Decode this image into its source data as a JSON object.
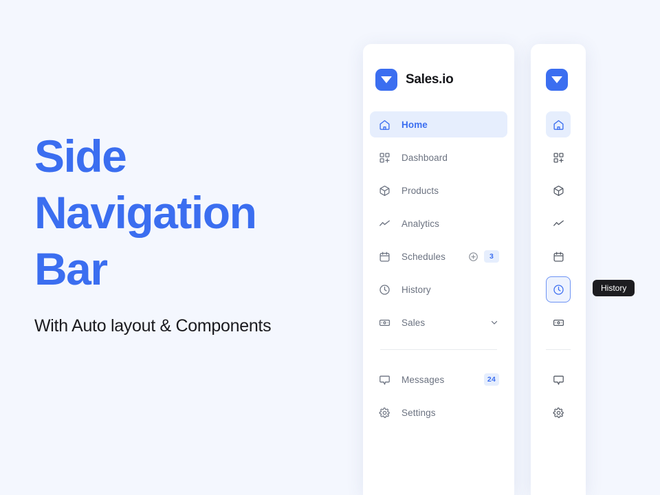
{
  "page": {
    "background_color": "#f4f7fe",
    "accent_color": "#3b6ef0",
    "muted_text_color": "#6b7280"
  },
  "hero": {
    "title": "Side\nNavigation\nBar",
    "subtitle": "With Auto layout & Components"
  },
  "sidebar": {
    "brand": {
      "name": "Sales.io",
      "logo_icon": "triangle-down-icon",
      "logo_color": "#3b6ef0"
    },
    "items": [
      {
        "label": "Home",
        "icon": "home-icon",
        "active": true,
        "badge": null,
        "action_icon": null,
        "chevron": false
      },
      {
        "label": "Dashboard",
        "icon": "dashboard-icon",
        "active": false,
        "badge": null,
        "action_icon": null,
        "chevron": false
      },
      {
        "label": "Products",
        "icon": "box-icon",
        "active": false,
        "badge": null,
        "action_icon": null,
        "chevron": false
      },
      {
        "label": "Analytics",
        "icon": "chart-line-icon",
        "active": false,
        "badge": null,
        "action_icon": null,
        "chevron": false
      },
      {
        "label": "Schedules",
        "icon": "calendar-icon",
        "active": false,
        "badge": "3",
        "action_icon": "plus-circle-icon",
        "chevron": false
      },
      {
        "label": "History",
        "icon": "clock-icon",
        "active": false,
        "badge": null,
        "action_icon": null,
        "chevron": false
      },
      {
        "label": "Sales",
        "icon": "banknote-icon",
        "active": false,
        "badge": null,
        "action_icon": null,
        "chevron": true
      }
    ],
    "bottom_items": [
      {
        "label": "Messages",
        "icon": "message-icon",
        "badge": "24"
      },
      {
        "label": "Settings",
        "icon": "gear-icon",
        "badge": null
      }
    ]
  },
  "rail": {
    "brand": {
      "logo_icon": "triangle-down-icon"
    },
    "items": [
      {
        "icon": "home-icon",
        "name": "home",
        "state": "active"
      },
      {
        "icon": "dashboard-icon",
        "name": "dashboard",
        "state": "default"
      },
      {
        "icon": "box-icon",
        "name": "products",
        "state": "default"
      },
      {
        "icon": "chart-line-icon",
        "name": "analytics",
        "state": "default"
      },
      {
        "icon": "calendar-icon",
        "name": "schedules",
        "state": "default"
      },
      {
        "icon": "clock-icon",
        "name": "history",
        "state": "focused"
      },
      {
        "icon": "banknote-icon",
        "name": "sales",
        "state": "default"
      }
    ],
    "bottom_items": [
      {
        "icon": "message-icon",
        "name": "messages"
      },
      {
        "icon": "gear-icon",
        "name": "settings"
      }
    ]
  },
  "tooltip": {
    "label": "History",
    "background_color": "#1d1d20"
  }
}
